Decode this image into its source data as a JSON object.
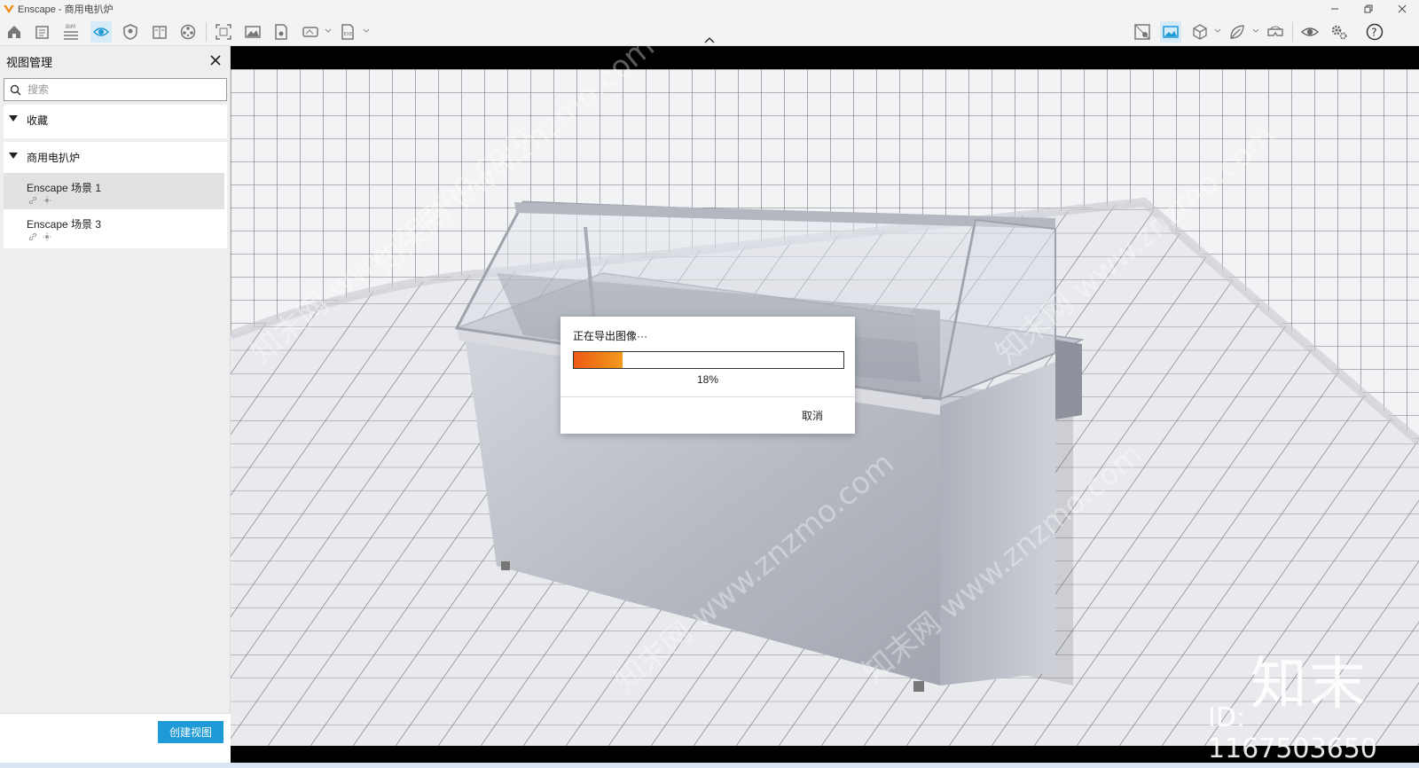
{
  "window": {
    "title": "Enscape - 商用电扒炉",
    "controls": [
      "minimize",
      "restore",
      "close"
    ]
  },
  "toolbar": {
    "left_icons": [
      "home-icon",
      "document-icon",
      "bim-icon",
      "eye-icon",
      "shield-icon",
      "book-icon",
      "reel-icon",
      "screenshot-icon",
      "image-icon",
      "export-file-icon",
      "panorama-icon",
      "exe-export-icon"
    ],
    "right_icons": [
      "asset-icon",
      "landscape-icon",
      "cube-icon",
      "leaf-icon",
      "vr-headset-icon",
      "visibility-icon",
      "settings-icon",
      "help-icon"
    ],
    "bim_label": "BIM",
    "exe_label": "EXE"
  },
  "sidebar": {
    "title": "视图管理",
    "search": {
      "placeholder": "搜索",
      "value": ""
    },
    "sections": [
      {
        "label": "收藏",
        "expanded": true,
        "items": []
      },
      {
        "label": "商用电扒炉",
        "expanded": true,
        "items": [
          {
            "name": "Enscape 场景 1",
            "selected": true
          },
          {
            "name": "Enscape 场景 3",
            "selected": false
          }
        ]
      }
    ],
    "create_button": "创建视图"
  },
  "dialog": {
    "title": "正在导出图像···",
    "progress": 0.18,
    "progress_text": "18%",
    "cancel_label": "取消"
  },
  "watermark": {
    "brand": "知末",
    "id": "ID: 1167503650",
    "diagonal": "知末网 www.znzmo.com"
  },
  "colors": {
    "accent": "#1e9ad6",
    "progress_start": "#ec5a14",
    "progress_end": "#f39a1c",
    "logo_orange": "#f28a1c"
  }
}
